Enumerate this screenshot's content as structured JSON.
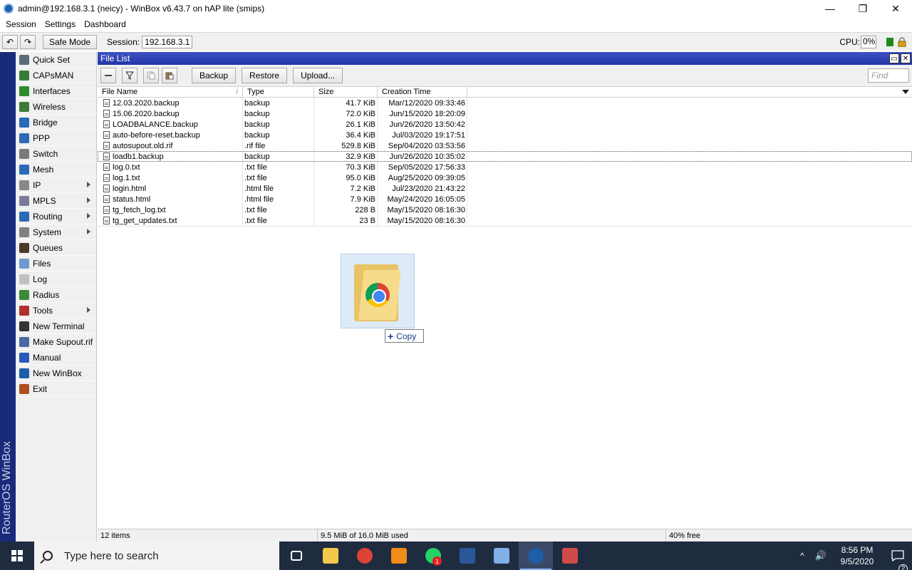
{
  "window": {
    "title": "admin@192.168.3.1 (neicy) - WinBox v6.43.7 on hAP lite (smips)",
    "minimize": "—",
    "maximize": "❐",
    "close": "✕"
  },
  "menu": [
    "Session",
    "Settings",
    "Dashboard"
  ],
  "toolbar": {
    "undo": "↶",
    "redo": "↷",
    "safe_mode": "Safe Mode",
    "session_label": "Session:",
    "session_value": "192.168.3.1",
    "cpu_label": "CPU:",
    "cpu_value": "0%"
  },
  "brand": "RouterOS WinBox",
  "sidebar": [
    {
      "label": "Quick Set",
      "icon": "quick-set-icon",
      "color": "#5a6a7a",
      "submenu": false
    },
    {
      "label": "CAPsMAN",
      "icon": "capsman-icon",
      "color": "#3a7a3a",
      "submenu": false
    },
    {
      "label": "Interfaces",
      "icon": "interfaces-icon",
      "color": "#2e8b2e",
      "submenu": false
    },
    {
      "label": "Wireless",
      "icon": "wireless-icon",
      "color": "#3a7a3a",
      "submenu": false
    },
    {
      "label": "Bridge",
      "icon": "bridge-icon",
      "color": "#2a6ab8",
      "submenu": false
    },
    {
      "label": "PPP",
      "icon": "ppp-icon",
      "color": "#2a6ab8",
      "submenu": false
    },
    {
      "label": "Switch",
      "icon": "switch-icon",
      "color": "#7a7a7a",
      "submenu": false
    },
    {
      "label": "Mesh",
      "icon": "mesh-icon",
      "color": "#2a6ab8",
      "submenu": false
    },
    {
      "label": "IP",
      "icon": "ip-icon",
      "color": "#888888",
      "submenu": true
    },
    {
      "label": "MPLS",
      "icon": "mpls-icon",
      "color": "#7a7a9a",
      "submenu": true
    },
    {
      "label": "Routing",
      "icon": "routing-icon",
      "color": "#2a6ab8",
      "submenu": true
    },
    {
      "label": "System",
      "icon": "system-icon",
      "color": "#808080",
      "submenu": true
    },
    {
      "label": "Queues",
      "icon": "queues-icon",
      "color": "#4a3a2a",
      "submenu": false
    },
    {
      "label": "Files",
      "icon": "files-icon",
      "color": "#6a9ad0",
      "submenu": false
    },
    {
      "label": "Log",
      "icon": "log-icon",
      "color": "#c0c0c0",
      "submenu": false
    },
    {
      "label": "Radius",
      "icon": "radius-icon",
      "color": "#3a8a3a",
      "submenu": false
    },
    {
      "label": "Tools",
      "icon": "tools-icon",
      "color": "#b03030",
      "submenu": true
    },
    {
      "label": "New Terminal",
      "icon": "terminal-icon",
      "color": "#333333",
      "submenu": false
    },
    {
      "label": "Make Supout.rif",
      "icon": "supout-icon",
      "color": "#4a6aa0",
      "submenu": false
    },
    {
      "label": "Manual",
      "icon": "manual-icon",
      "color": "#2a5ab8",
      "submenu": false
    },
    {
      "label": "New WinBox",
      "icon": "winbox-icon",
      "color": "#1d5ea8",
      "submenu": false
    },
    {
      "label": "Exit",
      "icon": "exit-icon",
      "color": "#b05020",
      "submenu": false
    }
  ],
  "file_list": {
    "title": "File List",
    "buttons": {
      "backup": "Backup",
      "restore": "Restore",
      "upload": "Upload..."
    },
    "find_placeholder": "Find",
    "columns": [
      "File Name",
      "Type",
      "Size",
      "Creation Time"
    ],
    "rows": [
      {
        "name": "12.03.2020.backup",
        "type": "backup",
        "size": "41.7 KiB",
        "time": "Mar/12/2020 09:33:46",
        "selected": false
      },
      {
        "name": "15.06.2020.backup",
        "type": "backup",
        "size": "72.0 KiB",
        "time": "Jun/15/2020 18:20:09",
        "selected": false
      },
      {
        "name": "LOADBALANCE.backup",
        "type": "backup",
        "size": "26.1 KiB",
        "time": "Jun/26/2020 13:50:42",
        "selected": false
      },
      {
        "name": "auto-before-reset.backup",
        "type": "backup",
        "size": "36.4 KiB",
        "time": "Jul/03/2020 19:17:51",
        "selected": false
      },
      {
        "name": "autosupout.old.rif",
        "type": ".rif file",
        "size": "529.8 KiB",
        "time": "Sep/04/2020 03:53:56",
        "selected": false
      },
      {
        "name": "loadb1.backup",
        "type": "backup",
        "size": "32.9 KiB",
        "time": "Jun/26/2020 10:35:02",
        "selected": true
      },
      {
        "name": "log.0.txt",
        "type": ".txt file",
        "size": "70.3 KiB",
        "time": "Sep/05/2020 17:56:33",
        "selected": false
      },
      {
        "name": "log.1.txt",
        "type": ".txt file",
        "size": "95.0 KiB",
        "time": "Aug/25/2020 09:39:05",
        "selected": false
      },
      {
        "name": "login.html",
        "type": ".html file",
        "size": "7.2 KiB",
        "time": "Jul/23/2020 21:43:22",
        "selected": false
      },
      {
        "name": "status.html",
        "type": ".html file",
        "size": "7.9 KiB",
        "time": "May/24/2020 16:05:05",
        "selected": false
      },
      {
        "name": "tg_fetch_log.txt",
        "type": ".txt file",
        "size": "228 B",
        "time": "May/15/2020 08:16:30",
        "selected": false
      },
      {
        "name": "tg_get_updates.txt",
        "type": ".txt file",
        "size": "23 B",
        "time": "May/15/2020 08:16:30",
        "selected": false
      }
    ],
    "status": {
      "items": "12 items",
      "used": "9.5 MiB of 16.0 MiB used",
      "free": "40% free"
    }
  },
  "drag": {
    "copy_label": "Copy"
  },
  "taskbar": {
    "search_placeholder": "Type here to search",
    "apps": [
      {
        "icon": "task-view-icon",
        "active": false
      },
      {
        "icon": "file-explorer-icon",
        "active": false
      },
      {
        "icon": "chrome-icon",
        "active": false
      },
      {
        "icon": "vlc-icon",
        "active": false
      },
      {
        "icon": "whatsapp-icon",
        "active": false,
        "badge": "1"
      },
      {
        "icon": "word-icon",
        "active": false
      },
      {
        "icon": "paint-icon",
        "active": false
      },
      {
        "icon": "winbox-taskbar-icon",
        "active": true
      },
      {
        "icon": "snipping-tool-icon",
        "active": false
      }
    ],
    "time": "8:56 PM",
    "date": "9/5/2020",
    "notification_count": "2"
  }
}
